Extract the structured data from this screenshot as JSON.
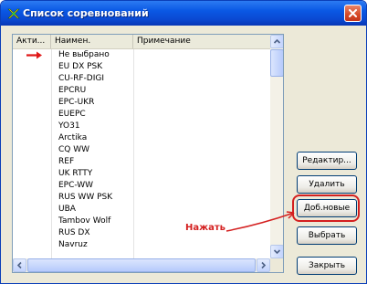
{
  "window": {
    "title": "Список соревнований"
  },
  "list": {
    "columns": [
      "Акти...",
      "Наимен.",
      "Примечание"
    ],
    "rows": [
      {
        "name": "Не выбрано",
        "active_marker": true
      },
      {
        "name": "EU DX PSK"
      },
      {
        "name": "CU-RF-DIGI"
      },
      {
        "name": "EPCRU"
      },
      {
        "name": "EPC-UKR"
      },
      {
        "name": "EUEPC"
      },
      {
        "name": "YO31"
      },
      {
        "name": "Arctika"
      },
      {
        "name": "CQ WW"
      },
      {
        "name": "REF"
      },
      {
        "name": "UK RTTY"
      },
      {
        "name": "EPC-WW"
      },
      {
        "name": "RUS WW PSK"
      },
      {
        "name": "UBA"
      },
      {
        "name": "Tambov Wolf"
      },
      {
        "name": "RUS DX"
      },
      {
        "name": "Navruz"
      }
    ]
  },
  "buttons": {
    "edit": "Редактир...",
    "delete": "Удалить",
    "add_new": "Доб.новые",
    "select": "Выбрать",
    "close": "Закрыть"
  },
  "annotation": {
    "text": "Нажать",
    "color": "#d42020"
  },
  "icons": {
    "title": "app-logo-icon",
    "close": "close-icon",
    "row_marker": "red-arrow-icon"
  },
  "colors": {
    "titlebar": "#0a58e4",
    "accent": "#d42020",
    "client": "#ece9d8"
  }
}
